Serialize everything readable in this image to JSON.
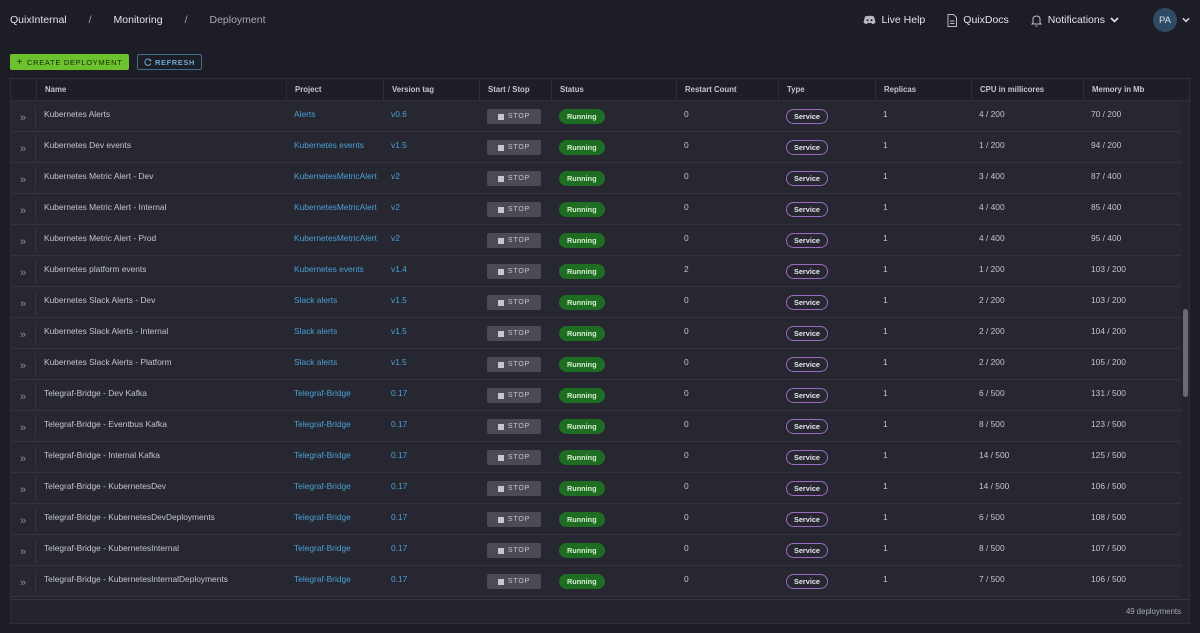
{
  "breadcrumb": [
    "QuixInternal",
    "Monitoring",
    "Deployment"
  ],
  "top_nav": {
    "live_help": "Live Help",
    "docs": "QuixDocs",
    "notifications": "Notifications",
    "avatar_initials": "PA"
  },
  "actions": {
    "create": "CREATE DEPLOYMENT",
    "refresh": "REFRESH"
  },
  "table": {
    "columns": [
      "Name",
      "Project",
      "Version tag",
      "Start / Stop",
      "Status",
      "Restart Count",
      "Type",
      "Replicas",
      "CPU in millicores",
      "Memory in Mb"
    ],
    "stop_label": "STOP",
    "rows": [
      {
        "name": "Kubernetes Alerts",
        "project": "Alerts",
        "version": "v0.6",
        "status": "Running",
        "restarts": "0",
        "type": "Service",
        "replicas": "1",
        "cpu": "4 / 200",
        "memory": "70 / 200"
      },
      {
        "name": "Kubernetes Dev events",
        "project": "Kubernetes events",
        "version": "v1.5",
        "status": "Running",
        "restarts": "0",
        "type": "Service",
        "replicas": "1",
        "cpu": "1 / 200",
        "memory": "94 / 200"
      },
      {
        "name": "Kubernetes Metric Alert - Dev",
        "project": "KubernetesMetricAlert",
        "version": "v2",
        "status": "Running",
        "restarts": "0",
        "type": "Service",
        "replicas": "1",
        "cpu": "3 / 400",
        "memory": "87 / 400"
      },
      {
        "name": "Kubernetes Metric Alert - Internal",
        "project": "KubernetesMetricAlert",
        "version": "v2",
        "status": "Running",
        "restarts": "0",
        "type": "Service",
        "replicas": "1",
        "cpu": "4 / 400",
        "memory": "85 / 400"
      },
      {
        "name": "Kubernetes Metric Alert - Prod",
        "project": "KubernetesMetricAlert",
        "version": "v2",
        "status": "Running",
        "restarts": "0",
        "type": "Service",
        "replicas": "1",
        "cpu": "4 / 400",
        "memory": "95 / 400"
      },
      {
        "name": "Kubernetes platform events",
        "project": "Kubernetes events",
        "version": "v1.4",
        "status": "Running",
        "restarts": "2",
        "type": "Service",
        "replicas": "1",
        "cpu": "1 / 200",
        "memory": "103 / 200"
      },
      {
        "name": "Kubernetes Slack Alerts - Dev",
        "project": "Slack alerts",
        "version": "v1.5",
        "status": "Running",
        "restarts": "0",
        "type": "Service",
        "replicas": "1",
        "cpu": "2 / 200",
        "memory": "103 / 200"
      },
      {
        "name": "Kubernetes Slack Alerts - Internal",
        "project": "Slack alerts",
        "version": "v1.5",
        "status": "Running",
        "restarts": "0",
        "type": "Service",
        "replicas": "1",
        "cpu": "2 / 200",
        "memory": "104 / 200"
      },
      {
        "name": "Kubernetes Slack Alerts - Platform",
        "project": "Slack alerts",
        "version": "v1.5",
        "status": "Running",
        "restarts": "0",
        "type": "Service",
        "replicas": "1",
        "cpu": "2 / 200",
        "memory": "105 / 200"
      },
      {
        "name": "Telegraf-Bridge - Dev Kafka",
        "project": "Telegraf-Bridge",
        "version": "0.17",
        "status": "Running",
        "restarts": "0",
        "type": "Service",
        "replicas": "1",
        "cpu": "6 / 500",
        "memory": "131 / 500"
      },
      {
        "name": "Telegraf-Bridge - Eventbus Kafka",
        "project": "Telegraf-Bridge",
        "version": "0.17",
        "status": "Running",
        "restarts": "0",
        "type": "Service",
        "replicas": "1",
        "cpu": "8 / 500",
        "memory": "123 / 500"
      },
      {
        "name": "Telegraf-Bridge - Internal Kafka",
        "project": "Telegraf-Bridge",
        "version": "0.17",
        "status": "Running",
        "restarts": "0",
        "type": "Service",
        "replicas": "1",
        "cpu": "14 / 500",
        "memory": "125 / 500"
      },
      {
        "name": "Telegraf-Bridge - KubernetesDev",
        "project": "Telegraf-Bridge",
        "version": "0.17",
        "status": "Running",
        "restarts": "0",
        "type": "Service",
        "replicas": "1",
        "cpu": "14 / 500",
        "memory": "106 / 500"
      },
      {
        "name": "Telegraf-Bridge - KubernetesDevDeployments",
        "project": "Telegraf-Bridge",
        "version": "0.17",
        "status": "Running",
        "restarts": "0",
        "type": "Service",
        "replicas": "1",
        "cpu": "6 / 500",
        "memory": "108 / 500"
      },
      {
        "name": "Telegraf-Bridge - KubernetesInternal",
        "project": "Telegraf-Bridge",
        "version": "0.17",
        "status": "Running",
        "restarts": "0",
        "type": "Service",
        "replicas": "1",
        "cpu": "8 / 500",
        "memory": "107 / 500"
      },
      {
        "name": "Telegraf-Bridge - KubernetesInternalDeployments",
        "project": "Telegraf-Bridge",
        "version": "0.17",
        "status": "Running",
        "restarts": "0",
        "type": "Service",
        "replicas": "1",
        "cpu": "7 / 500",
        "memory": "106 / 500"
      }
    ],
    "footer_count": "49 deployments"
  },
  "colors": {
    "accent_green": "#6bc22c",
    "running": "#1e6d22",
    "link": "#4ba0d6",
    "service_border": "#9b6bbf"
  }
}
